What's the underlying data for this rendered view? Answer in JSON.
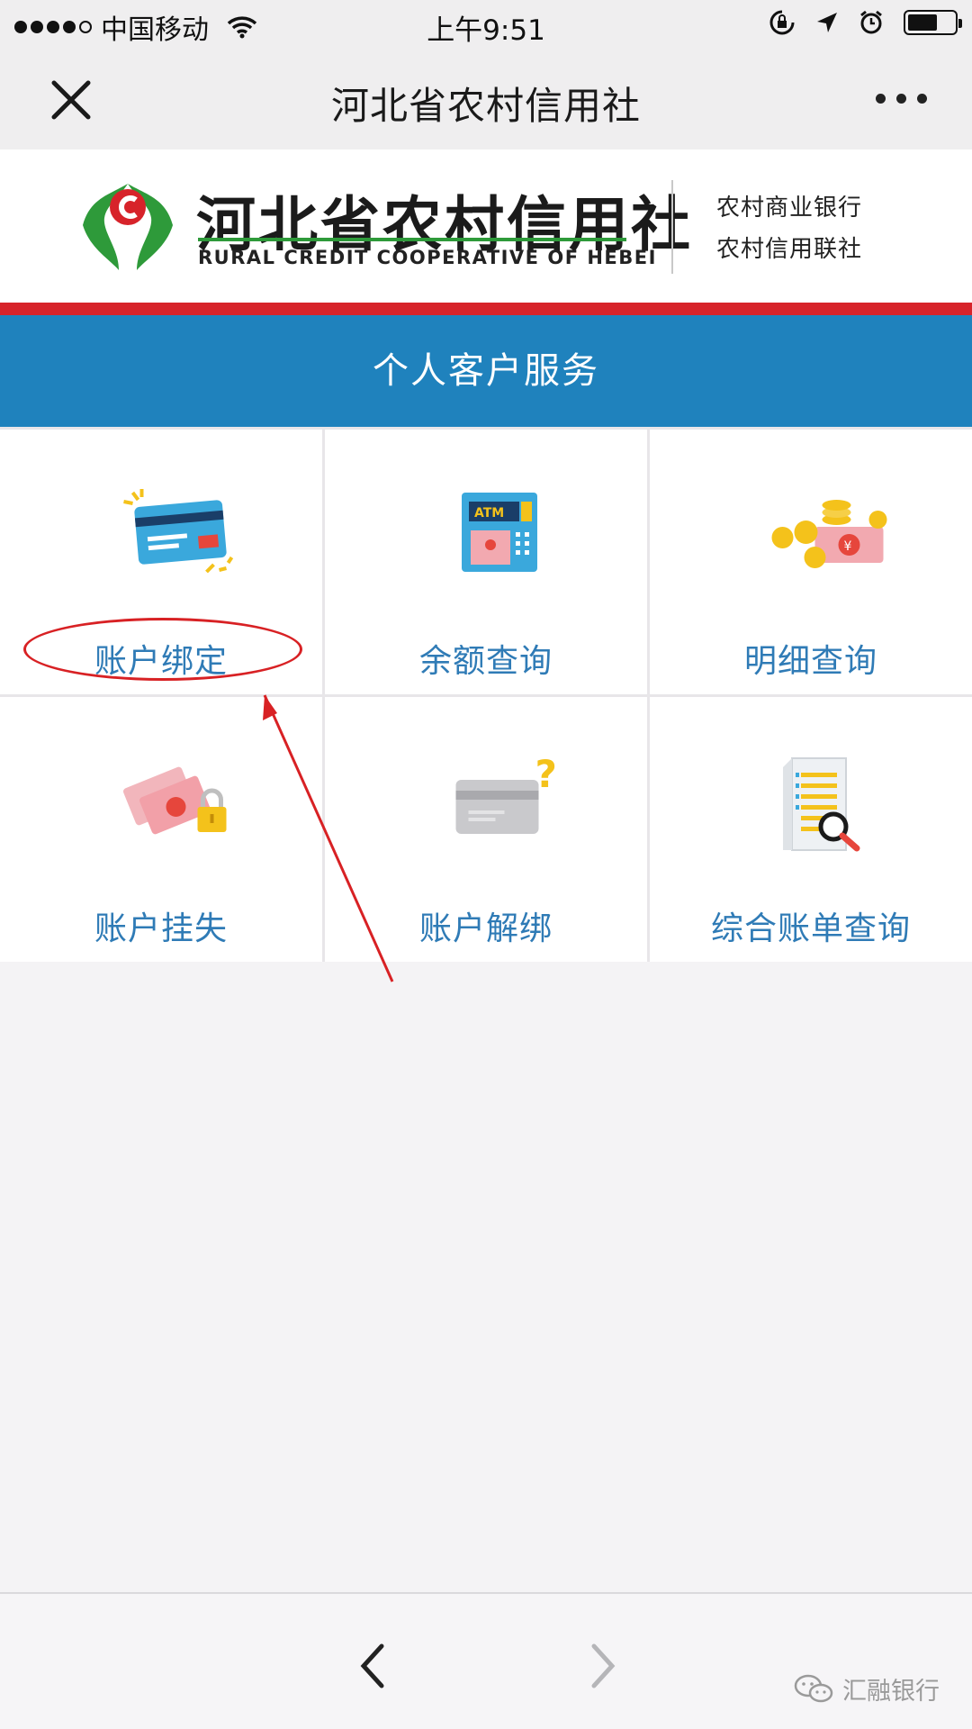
{
  "status_bar": {
    "carrier": "中国移动",
    "time": "上午9:51"
  },
  "nav": {
    "title": "河北省农村信用社"
  },
  "banner": {
    "name_cn": "河北省农村信用社",
    "name_en": "RURAL CREDIT COOPERATIVE OF HEBEI",
    "sub_name_1": "农村商业银行",
    "sub_name_2": "农村信用联社"
  },
  "section": {
    "title": "个人客户服务"
  },
  "services": [
    {
      "label": "账户绑定",
      "icon": "bank-card-icon"
    },
    {
      "label": "余额查询",
      "icon": "atm-icon"
    },
    {
      "label": "明细查询",
      "icon": "money-coins-icon"
    },
    {
      "label": "账户挂失",
      "icon": "money-lock-icon"
    },
    {
      "label": "账户解绑",
      "icon": "card-question-icon"
    },
    {
      "label": "综合账单查询",
      "icon": "document-search-icon"
    }
  ],
  "watermark": {
    "text": "汇融银行"
  },
  "colors": {
    "header_blue": "#1f82bd",
    "stripe_red": "#d7232a",
    "label_blue": "#2f7bb6",
    "logo_green": "#2e9a3a",
    "annotation_red": "#d82124"
  }
}
